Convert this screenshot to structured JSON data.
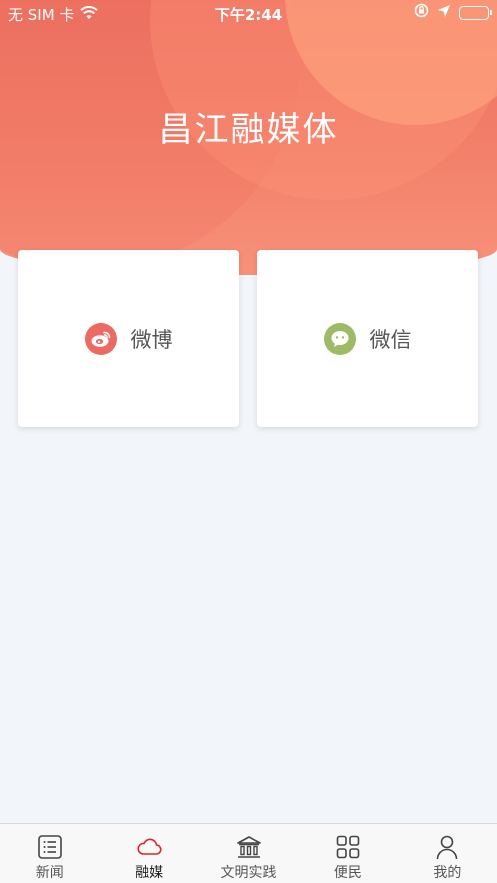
{
  "status_bar": {
    "carrier": "无 SIM 卡",
    "time": "下午2:44"
  },
  "header": {
    "title": "昌江融媒体"
  },
  "cards": [
    {
      "label": "微博",
      "icon": "weibo-icon",
      "color": "#ec6a63"
    },
    {
      "label": "微信",
      "icon": "wechat-icon",
      "color": "#9dbb66"
    }
  ],
  "tabbar": {
    "items": [
      {
        "label": "新闻",
        "icon": "news-list-icon"
      },
      {
        "label": "融媒",
        "icon": "cloud-icon",
        "active": true
      },
      {
        "label": "文明实践",
        "icon": "building-icon"
      },
      {
        "label": "便民",
        "icon": "grid-icon"
      },
      {
        "label": "我的",
        "icon": "user-icon"
      }
    ],
    "active_color": "#d9262c"
  },
  "colors": {
    "header": "#f2806a",
    "background": "#f2f5f9"
  }
}
